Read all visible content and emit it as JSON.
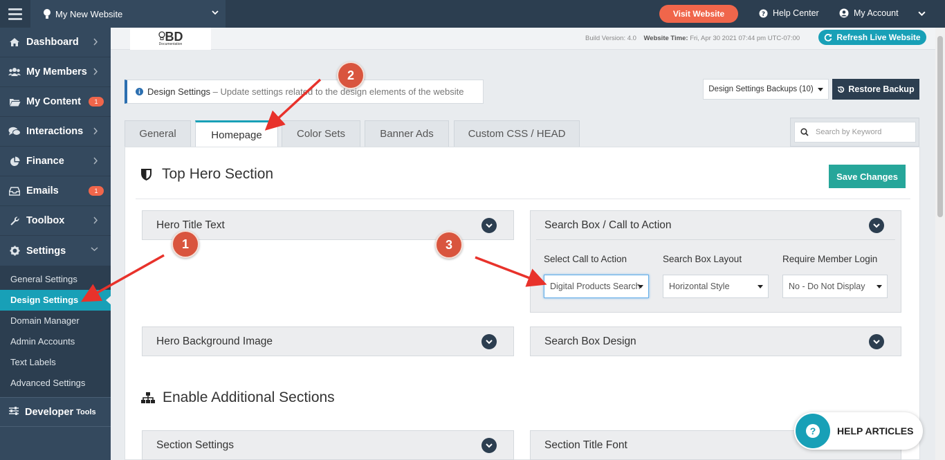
{
  "topbar": {
    "site_name": "My New Website",
    "visit_label": "Visit Website",
    "help_center_label": "Help Center",
    "my_account_label": "My Account"
  },
  "sidebar": {
    "items": [
      {
        "label": "Dashboard",
        "icon": "home-icon"
      },
      {
        "label": "My Members",
        "icon": "users-icon"
      },
      {
        "label": "My Content",
        "icon": "folder-icon",
        "badge": "1"
      },
      {
        "label": "Interactions",
        "icon": "comments-icon"
      },
      {
        "label": "Finance",
        "icon": "pie-chart-icon"
      },
      {
        "label": "Emails",
        "icon": "inbox-icon",
        "badge": "1"
      },
      {
        "label": "Toolbox",
        "icon": "wrench-icon"
      },
      {
        "label": "Settings",
        "icon": "gear-icon"
      }
    ],
    "settings_sub": [
      "General Settings",
      "Design Settings",
      "Domain Manager",
      "Admin Accounts",
      "Text Labels",
      "Advanced Settings"
    ],
    "developer_label": "Developer",
    "developer_small": "Tools"
  },
  "header": {
    "logo_text": "BD",
    "logo_sub": "Documentation",
    "build_label": "Build Version:",
    "build_value": "4.0",
    "time_label": "Website Time:",
    "time_value": "Fri, Apr 30 2021 07:44 pm UTC-07:00",
    "refresh_label": "Refresh Live Website"
  },
  "notice": {
    "title": "Design Settings",
    "text": " – Update settings related to the design elements of the website"
  },
  "backups": {
    "dropdown_label": "Design Settings Backups (10)",
    "restore_label": "Restore Backup"
  },
  "tabs": [
    "General",
    "Homepage",
    "Color Sets",
    "Banner Ads",
    "Custom CSS / HEAD"
  ],
  "search": {
    "placeholder": "Search by Keyword"
  },
  "main": {
    "section_title": "Top Hero Section",
    "save_label": "Save Changes",
    "hero_title_text": "Hero Title Text",
    "hero_bg_image": "Hero Background Image",
    "searchbox_cta": "Search Box / Call to Action",
    "searchbox_design": "Search Box Design",
    "fields": {
      "cta_label": "Select Call to Action",
      "cta_value": "Digital Products Search",
      "layout_label": "Search Box Layout",
      "layout_value": "Horizontal Style",
      "login_label": "Require Member Login",
      "login_value": "No - Do Not Display"
    },
    "section2_title": "Enable Additional Sections",
    "section_settings": "Section Settings",
    "section_title_font": "Section Title Font"
  },
  "help_articles": "HELP ARTICLES",
  "annotations": {
    "steps": [
      "1",
      "2",
      "3"
    ],
    "color": "#e8322b"
  },
  "colors": {
    "accent": "#18a0b7",
    "nav": "#34495e",
    "orange": "#f0664b",
    "save": "#26a69a"
  }
}
